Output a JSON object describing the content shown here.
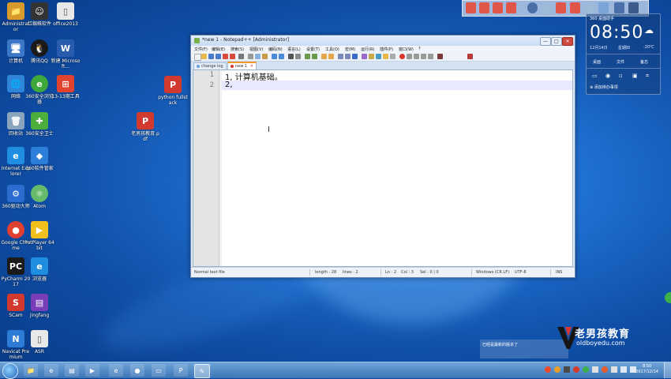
{
  "desktop_icons": [
    {
      "label": "Administrator",
      "color": "#d89a2a"
    },
    {
      "label": "计算机",
      "color": "#3d78c8"
    },
    {
      "label": "网络",
      "color": "#2f86d8"
    },
    {
      "label": "回收站",
      "color": "#8aa3bf"
    },
    {
      "label": "Internet Explorer",
      "color": "#1f8ee0"
    },
    {
      "label": "360驱动大师",
      "color": "#2a6ccf"
    },
    {
      "label": "Google Chrome",
      "color": "#e0402f"
    },
    {
      "label": "PyCharm 2017",
      "color": "#1a1a1a"
    },
    {
      "label": "SCam",
      "color": "#d23a2f"
    },
    {
      "label": "Navicat Premium",
      "color": "#2e7bd6"
    },
    {
      "label": "红蜘蛛软件",
      "color": "#333333"
    },
    {
      "label": "腾讯QQ",
      "color": "#1a1a1a"
    },
    {
      "label": "360安全浏览器",
      "color": "#3ea83a"
    },
    {
      "label": "360安全卫士",
      "color": "#4cae3c"
    },
    {
      "label": "360软件管家",
      "color": "#2b7fd8"
    },
    {
      "label": "Atom",
      "color": "#66bb6a"
    },
    {
      "label": "PotPlayer 64 bit",
      "color": "#f2c01d"
    },
    {
      "label": "浏览器",
      "color": "#1f8ee0"
    },
    {
      "label": "jingfang",
      "color": "#7a3db8"
    },
    {
      "label": "ASR",
      "color": "#e8e8e8"
    },
    {
      "label": "office2013",
      "color": "#e8e8e8"
    },
    {
      "label": "新建 Microsoft...",
      "color": "#2a5cad"
    },
    {
      "label": "13-13期工具",
      "color": "#e2432f"
    },
    {
      "label": "python fullstack",
      "color": "#d23a2f"
    },
    {
      "label": "老男孩教育.pdf",
      "color": "#d23a2f"
    }
  ],
  "window": {
    "title": "*new 1 - Notepad++ [Administrator]",
    "menu": [
      "文件(F)",
      "编辑(E)",
      "搜索(S)",
      "视图(V)",
      "编码(N)",
      "语言(L)",
      "设置(T)",
      "工具(O)",
      "宏(M)",
      "运行(R)",
      "插件(P)",
      "窗口(W)",
      "?"
    ],
    "tabs": [
      {
        "label": "change log",
        "active": false
      },
      {
        "label": "new 1",
        "active": true
      }
    ],
    "lines": [
      {
        "num": "1",
        "text": "1, 计算机基础。"
      },
      {
        "num": "2",
        "text": "2,"
      }
    ],
    "status": {
      "file_type": "Normal text file",
      "length": "length : 28",
      "lines": "lines : 2",
      "ln": "Ln : 2",
      "col": "Col : 3",
      "sel": "Sel : 0 | 0",
      "eol": "Windows (CR LF)",
      "encoding": "UTF-8",
      "mode": "INS"
    },
    "buttons": {
      "minimize": "—",
      "maximize": "□",
      "close": "✕"
    }
  },
  "widget": {
    "header": "360 桌面助手",
    "time": "08:50",
    "date": "12月14日",
    "weekday": "星期四",
    "temp": "-20℃",
    "actions": [
      "桌面",
      "文件",
      "备忘"
    ],
    "note": "添加待办事项"
  },
  "taskbar": {
    "time": "8:50",
    "date": "2017/12/14"
  },
  "logo": {
    "brand": "老男孩教育",
    "url": "oldboyedu.com"
  },
  "notification": "已经是最新的版本了"
}
